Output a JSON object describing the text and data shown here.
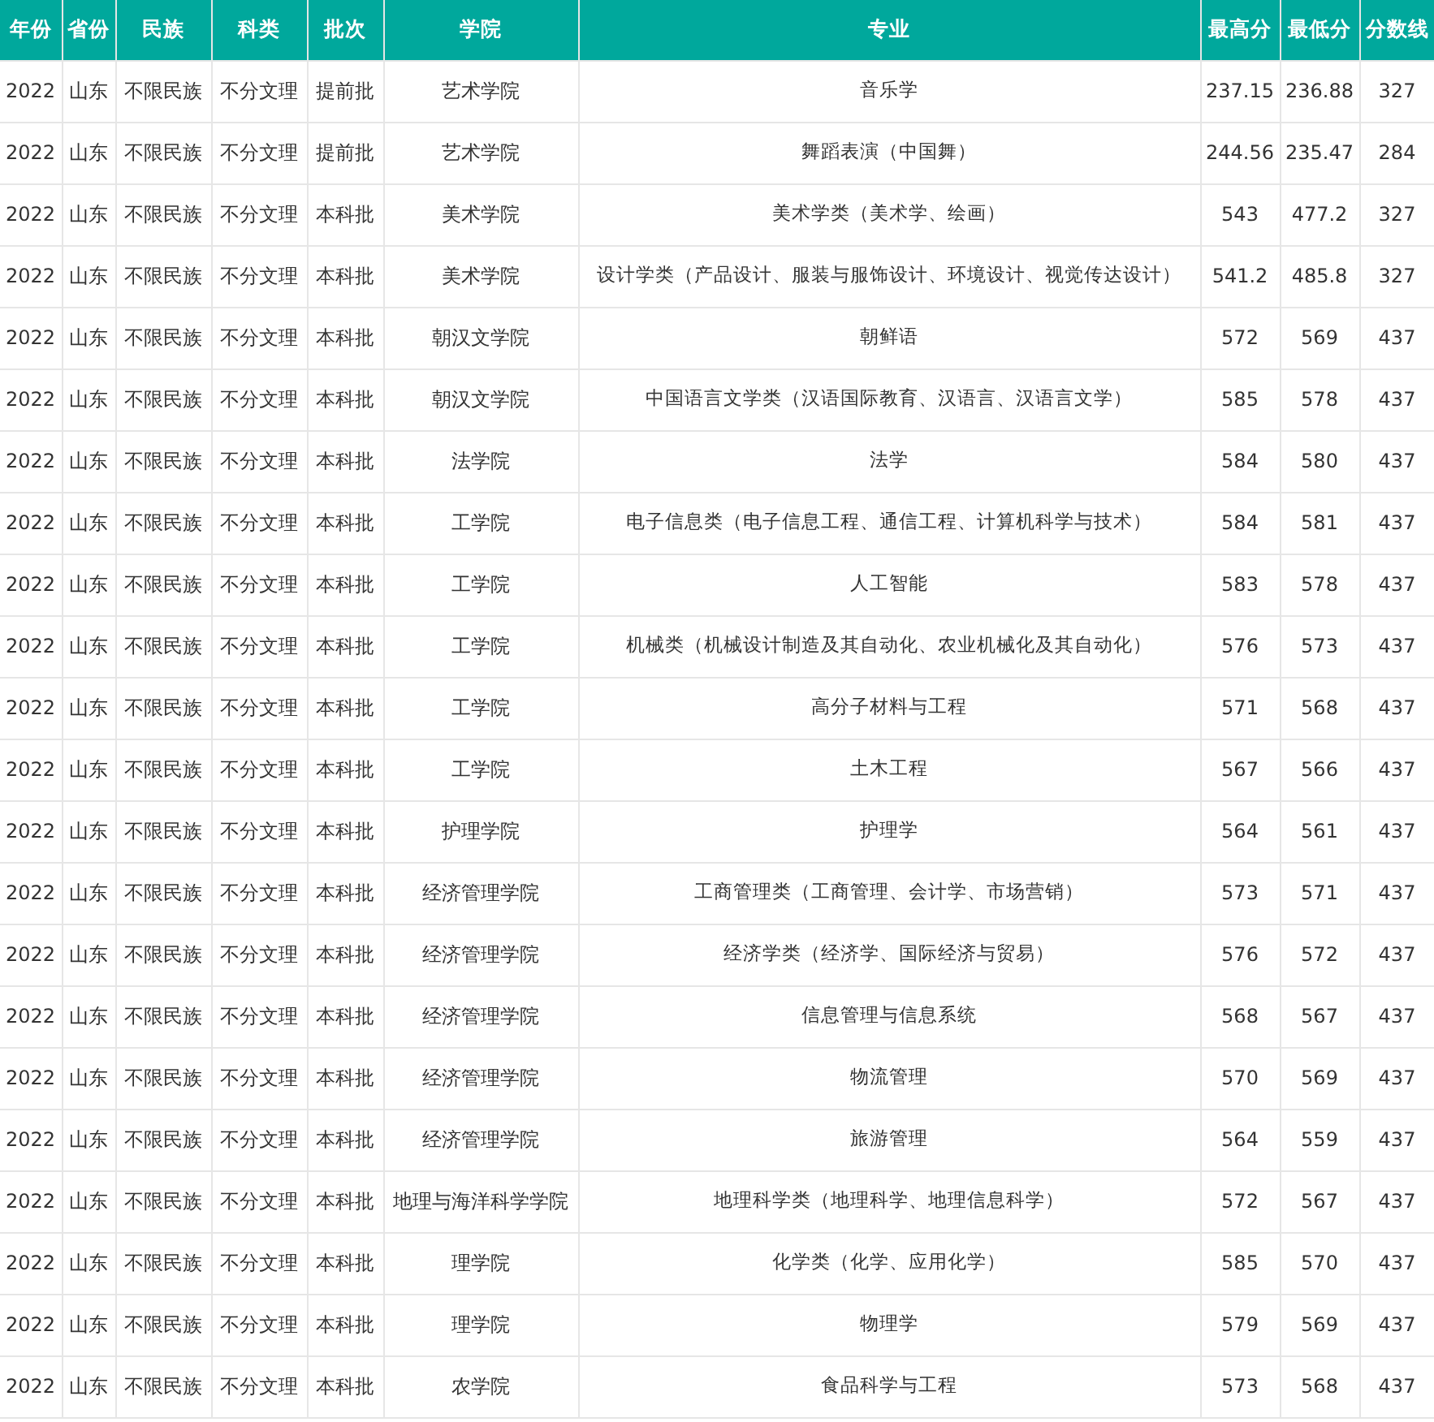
{
  "table": {
    "columns": [
      "年份",
      "省份",
      "民族",
      "科类",
      "批次",
      "学院",
      "专业",
      "最高分",
      "最低分",
      "分数线"
    ],
    "rows": [
      [
        "2022",
        "山东",
        "不限民族",
        "不分文理",
        "提前批",
        "艺术学院",
        "音乐学",
        "237.15",
        "236.88",
        "327"
      ],
      [
        "2022",
        "山东",
        "不限民族",
        "不分文理",
        "提前批",
        "艺术学院",
        "舞蹈表演（中国舞）",
        "244.56",
        "235.47",
        "284"
      ],
      [
        "2022",
        "山东",
        "不限民族",
        "不分文理",
        "本科批",
        "美术学院",
        "美术学类（美术学、绘画）",
        "543",
        "477.2",
        "327"
      ],
      [
        "2022",
        "山东",
        "不限民族",
        "不分文理",
        "本科批",
        "美术学院",
        "设计学类（产品设计、服装与服饰设计、环境设计、视觉传达设计）",
        "541.2",
        "485.8",
        "327"
      ],
      [
        "2022",
        "山东",
        "不限民族",
        "不分文理",
        "本科批",
        "朝汉文学院",
        "朝鲜语",
        "572",
        "569",
        "437"
      ],
      [
        "2022",
        "山东",
        "不限民族",
        "不分文理",
        "本科批",
        "朝汉文学院",
        "中国语言文学类（汉语国际教育、汉语言、汉语言文学）",
        "585",
        "578",
        "437"
      ],
      [
        "2022",
        "山东",
        "不限民族",
        "不分文理",
        "本科批",
        "法学院",
        "法学",
        "584",
        "580",
        "437"
      ],
      [
        "2022",
        "山东",
        "不限民族",
        "不分文理",
        "本科批",
        "工学院",
        "电子信息类（电子信息工程、通信工程、计算机科学与技术）",
        "584",
        "581",
        "437"
      ],
      [
        "2022",
        "山东",
        "不限民族",
        "不分文理",
        "本科批",
        "工学院",
        "人工智能",
        "583",
        "578",
        "437"
      ],
      [
        "2022",
        "山东",
        "不限民族",
        "不分文理",
        "本科批",
        "工学院",
        "机械类（机械设计制造及其自动化、农业机械化及其自动化）",
        "576",
        "573",
        "437"
      ],
      [
        "2022",
        "山东",
        "不限民族",
        "不分文理",
        "本科批",
        "工学院",
        "高分子材料与工程",
        "571",
        "568",
        "437"
      ],
      [
        "2022",
        "山东",
        "不限民族",
        "不分文理",
        "本科批",
        "工学院",
        "土木工程",
        "567",
        "566",
        "437"
      ],
      [
        "2022",
        "山东",
        "不限民族",
        "不分文理",
        "本科批",
        "护理学院",
        "护理学",
        "564",
        "561",
        "437"
      ],
      [
        "2022",
        "山东",
        "不限民族",
        "不分文理",
        "本科批",
        "经济管理学院",
        "工商管理类（工商管理、会计学、市场营销）",
        "573",
        "571",
        "437"
      ],
      [
        "2022",
        "山东",
        "不限民族",
        "不分文理",
        "本科批",
        "经济管理学院",
        "经济学类（经济学、国际经济与贸易）",
        "576",
        "572",
        "437"
      ],
      [
        "2022",
        "山东",
        "不限民族",
        "不分文理",
        "本科批",
        "经济管理学院",
        "信息管理与信息系统",
        "568",
        "567",
        "437"
      ],
      [
        "2022",
        "山东",
        "不限民族",
        "不分文理",
        "本科批",
        "经济管理学院",
        "物流管理",
        "570",
        "569",
        "437"
      ],
      [
        "2022",
        "山东",
        "不限民族",
        "不分文理",
        "本科批",
        "经济管理学院",
        "旅游管理",
        "564",
        "559",
        "437"
      ],
      [
        "2022",
        "山东",
        "不限民族",
        "不分文理",
        "本科批",
        "地理与海洋科学学院",
        "地理科学类（地理科学、地理信息科学）",
        "572",
        "567",
        "437"
      ],
      [
        "2022",
        "山东",
        "不限民族",
        "不分文理",
        "本科批",
        "理学院",
        "化学类（化学、应用化学）",
        "585",
        "570",
        "437"
      ],
      [
        "2022",
        "山东",
        "不限民族",
        "不分文理",
        "本科批",
        "理学院",
        "物理学",
        "579",
        "569",
        "437"
      ],
      [
        "2022",
        "山东",
        "不限民族",
        "不分文理",
        "本科批",
        "农学院",
        "食品科学与工程",
        "573",
        "568",
        "437"
      ]
    ]
  }
}
